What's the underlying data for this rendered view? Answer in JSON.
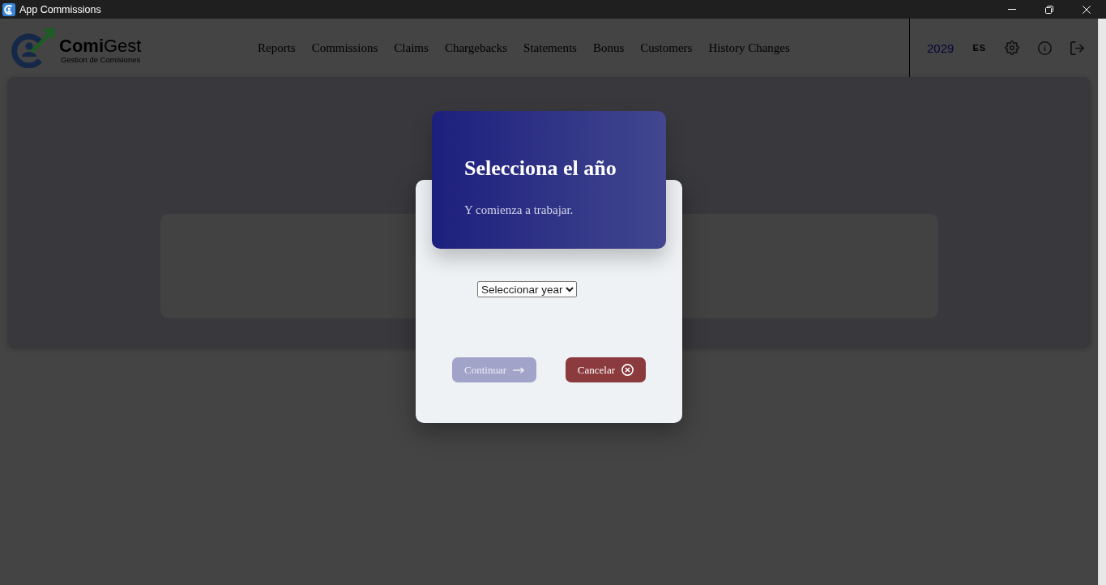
{
  "window": {
    "title": "App Commissions"
  },
  "header": {
    "logo": {
      "name": "**Comi**Gest",
      "tagline": "Gestion de Comisiones"
    },
    "nav": [
      "Reports",
      "Commissions",
      "Claims",
      "Chargebacks",
      "Statements",
      "Bonus",
      "Customers",
      "History Changes"
    ],
    "year": "2029",
    "language": "ES"
  },
  "dialog": {
    "title": "Selecciona el año",
    "subtitle": "Y comienza a trabajar.",
    "year_select": {
      "value": "Seleccionar year"
    },
    "buttons": [
      {
        "label": "Continuar",
        "kind": "primary",
        "disabled": true
      },
      {
        "label": "Cancelar",
        "kind": "cancel",
        "disabled": false
      }
    ]
  }
}
